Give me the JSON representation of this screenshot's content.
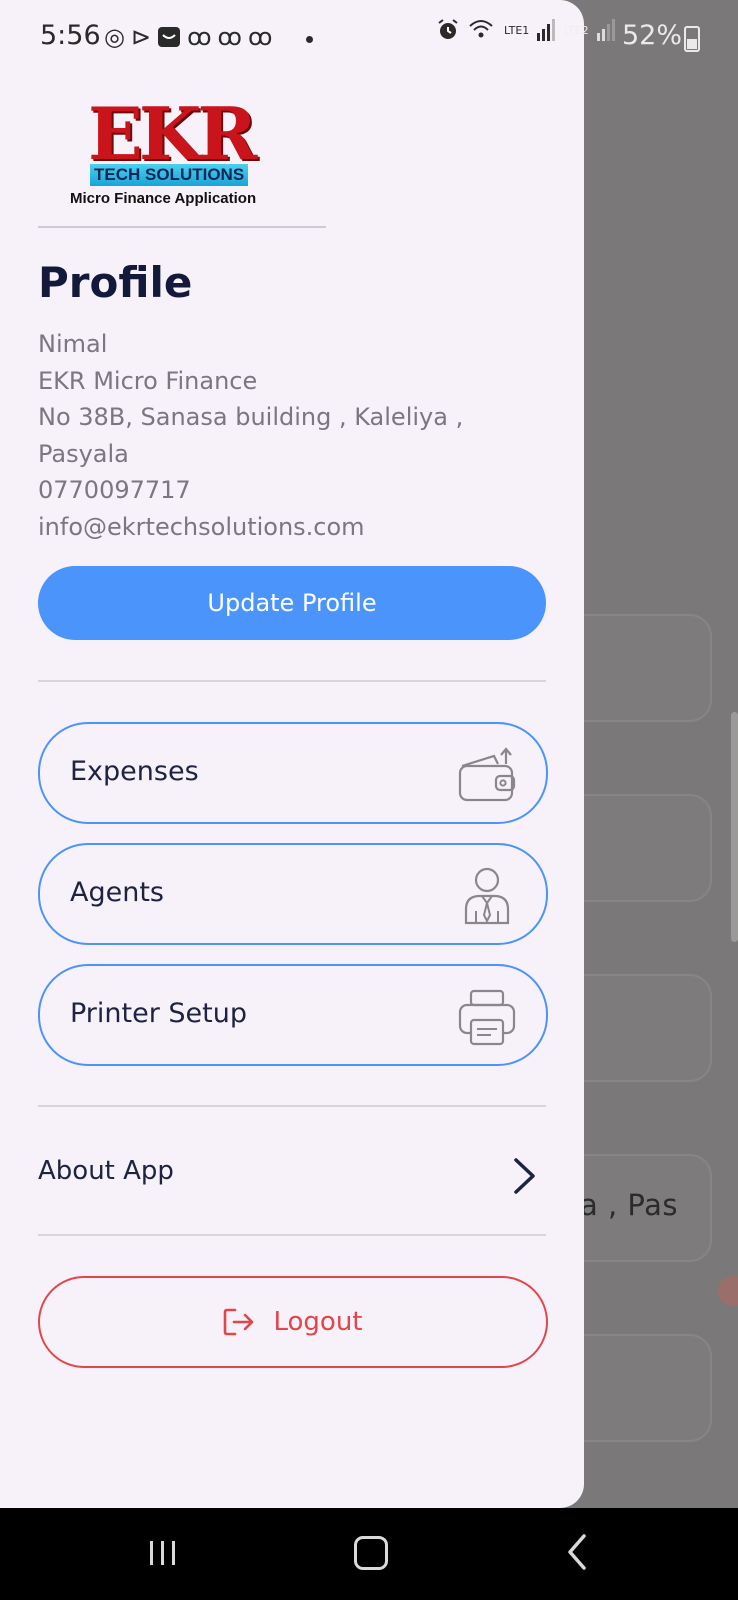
{
  "status_bar": {
    "time": "5:56",
    "left_icons": [
      "whatsapp-icon",
      "play-icon",
      "sms-icon",
      "link-icon",
      "link-icon",
      "link-icon"
    ],
    "right_icons": [
      "alarm-icon",
      "wifi-icon",
      "signal-lte1-icon",
      "signal-lte2-icon"
    ],
    "lte1_label": "LTE1",
    "lte2_label": "LTE2",
    "battery": "52%"
  },
  "drawer": {
    "logo": {
      "brand": "EKR",
      "tagline": "TECH SOLUTIONS",
      "subtitle": "Micro Finance Application"
    },
    "profile": {
      "title": "Profile",
      "name": "Nimal",
      "company": "EKR Micro Finance",
      "address_line1": "No 38B, Sanasa building , Kaleliya ,",
      "address_line2": "Pasyala",
      "phone": "0770097717",
      "email": "info@ekrtechsolutions.com"
    },
    "update_button": "Update Profile",
    "menu": [
      {
        "label": "Expenses",
        "icon": "wallet-icon"
      },
      {
        "label": "Agents",
        "icon": "agent-icon"
      },
      {
        "label": "Printer Setup",
        "icon": "printer-icon"
      }
    ],
    "about": {
      "label": "About App",
      "icon": "chevron-right-icon"
    },
    "logout": {
      "label": "Logout",
      "icon": "logout-icon"
    },
    "colors": {
      "accent": "#4a94fb",
      "danger": "#e0464a",
      "drawer_bg": "#f7f1f9"
    }
  },
  "background_app": {
    "partial_text": "a , Pas"
  },
  "nav_bar": {
    "buttons": [
      "recents-icon",
      "home-icon",
      "back-icon"
    ]
  }
}
